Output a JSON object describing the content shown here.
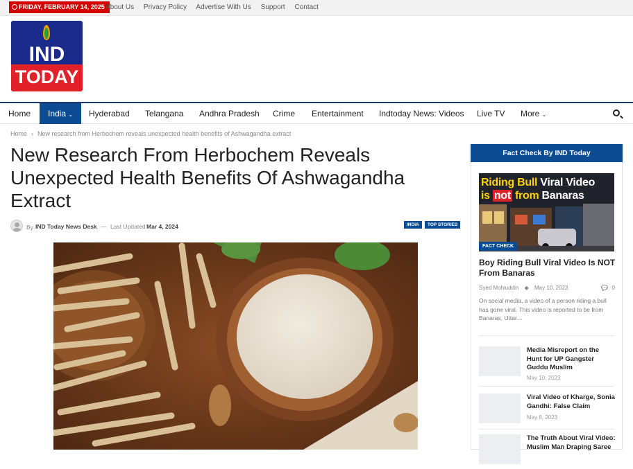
{
  "topbar": {
    "date": "FRIDAY, FEBRUARY 14, 2025",
    "links": [
      "About Us",
      "Privacy Policy",
      "Advertise With Us",
      "Support",
      "Contact"
    ]
  },
  "logo": {
    "line1": "IND",
    "line2": "TODAY"
  },
  "nav": {
    "items": [
      "Home",
      "India",
      "Hyderabad",
      "Telangana",
      "Andhra Pradesh",
      "Crime",
      "Entertainment",
      "Indtoday News: Videos",
      "Live TV",
      "More"
    ],
    "active": "India",
    "accent": "#0d4c93"
  },
  "breadcrumb": {
    "home": "Home",
    "current": "New research from Herbochem reveals unexpected health benefits of Ashwagandha extract"
  },
  "article": {
    "title": "New Research From Herbochem Reveals Unexpected Health Benefits Of Ashwagandha Extract",
    "by": "By",
    "author": "IND Today News Desk",
    "dash": "—",
    "last_updated_label": "Last Updated",
    "date": "Mar 4, 2024",
    "badges": [
      "INDIA",
      "TOP STORIES"
    ]
  },
  "sidebar": {
    "heading": "Fact Check By IND Today",
    "featured": {
      "image_line1_a": "Riding Bull ",
      "image_line1_b": "Viral Video",
      "image_line2_a": "is ",
      "image_line2_not": "not",
      "image_line2_b": " from ",
      "image_line2_c": "Banaras",
      "tag": "FACT CHECK",
      "title": "Boy Riding Bull Viral Video Is NOT From Banaras",
      "author": "Syed Mohiuddin",
      "date": "May 10, 2023",
      "comments": "0",
      "excerpt": "On social media, a video of a person riding a bull has gone viral. This video is reported to be from Banaras, Uttar…"
    },
    "list": [
      {
        "title": "Media Misreport on the Hunt for UP Gangster Guddu Muslim",
        "date": "May 10, 2023"
      },
      {
        "title": "Viral Video of Kharge, Sonia Gandhi: False Claim",
        "date": "May 8, 2023"
      },
      {
        "title": "The Truth About Viral Video: Muslim Man Draping Saree",
        "date": ""
      }
    ]
  }
}
